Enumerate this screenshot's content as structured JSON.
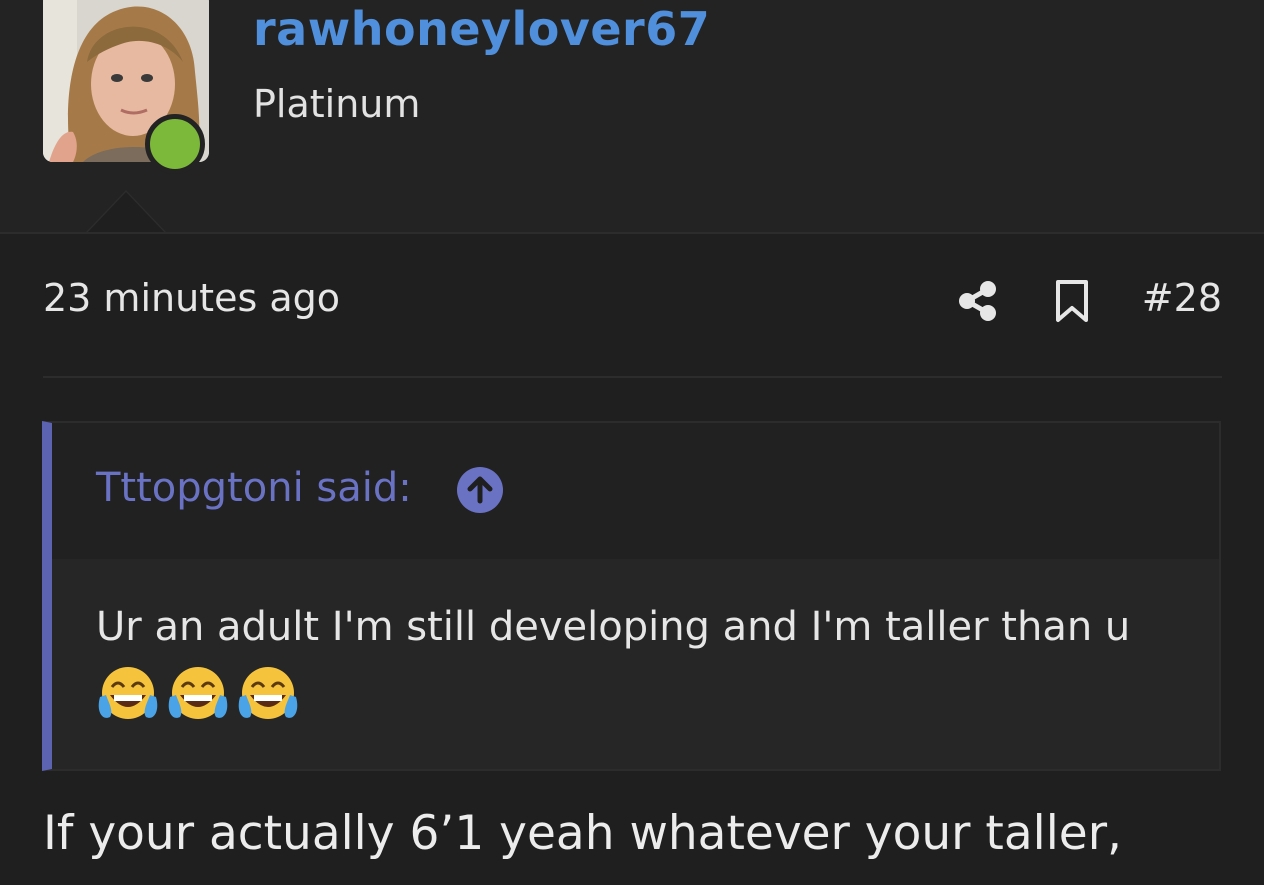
{
  "user": {
    "username": "rawhoneylover67",
    "title": "Platinum",
    "online": true
  },
  "post": {
    "timestamp": "23 minutes ago",
    "number": "#28",
    "share_icon": "share-icon",
    "bookmark_icon": "bookmark-icon"
  },
  "quote": {
    "author": "Tttopgtoni said:",
    "text": "Ur an adult I'm still developing and I'm taller than u",
    "emojis": [
      "😂",
      "😂",
      "😂"
    ]
  },
  "reply": {
    "line1": "If your actually 6’1 yeah whatever your taller,"
  },
  "colors": {
    "accent": "#4f8fdb",
    "quote_accent": "#6a72c4",
    "online": "#7cb83a",
    "background": "#1f1f1f"
  }
}
